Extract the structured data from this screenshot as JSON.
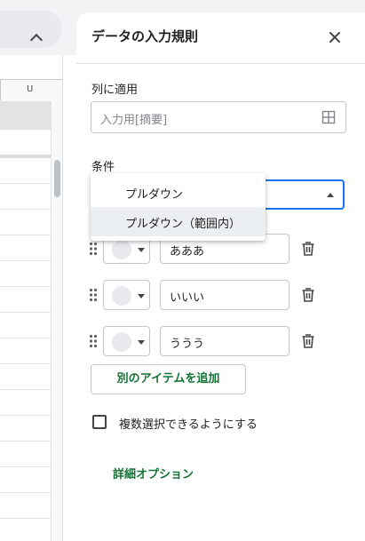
{
  "spreadsheet": {
    "column_header": "U",
    "collapse_icon": "chevron-up-icon"
  },
  "panel": {
    "title": "データの入力規則",
    "close_icon": "close-icon"
  },
  "apply_to_range": {
    "label": "列に適用",
    "placeholder": "入力用[摘要]",
    "icon": "grid-icon"
  },
  "criteria": {
    "label": "条件",
    "dropdown_icon": "caret-down-icon",
    "options": [
      {
        "label": "プルダウン"
      },
      {
        "label": "プルダウン（範囲内）"
      }
    ]
  },
  "items": [
    {
      "value": "あああ"
    },
    {
      "value": "いいい"
    },
    {
      "value": "ううう"
    }
  ],
  "add_item_button": "別のアイテムを追加",
  "multi_select": {
    "label": "複数選択できるようにする",
    "checked": false
  },
  "advanced_options": "詳細オプション",
  "colors": {
    "accent_green": "#137333",
    "focus_blue": "#1a73e8",
    "swatch": "#e8eaed"
  }
}
